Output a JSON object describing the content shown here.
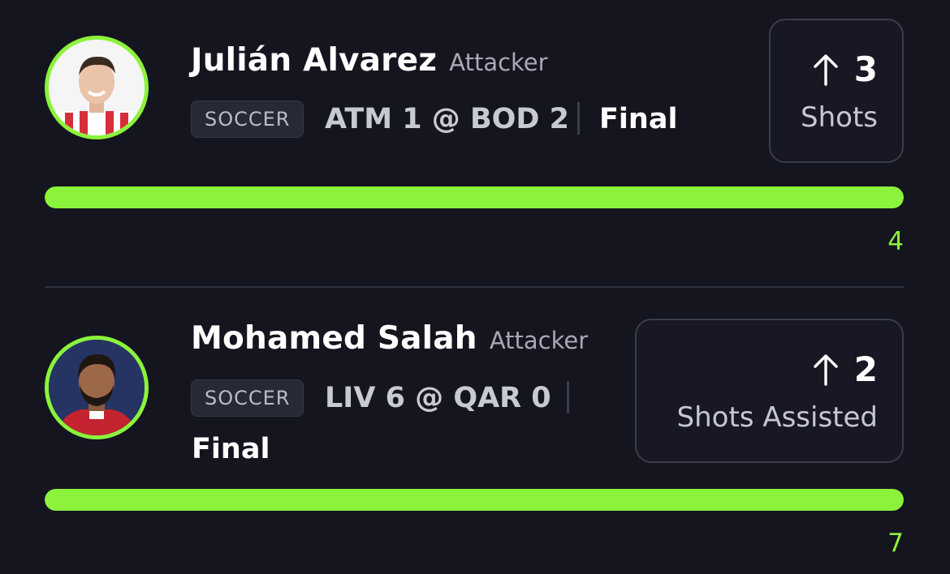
{
  "picks": [
    {
      "player": "Julián Alvarez",
      "position": "Attacker",
      "sport": "SOCCER",
      "score": "ATM 1 @ BOD 2",
      "status": "Final",
      "direction_icon": "arrow-up-icon",
      "line": "3",
      "stat": "Shots",
      "actual": "4",
      "progress": 1.0
    },
    {
      "player": "Mohamed Salah",
      "position": "Attacker",
      "sport": "SOCCER",
      "score": "LIV 6 @ QAR 0",
      "status": "Final",
      "direction_icon": "arrow-up-icon",
      "line": "2",
      "stat": "Shots Assisted",
      "actual": "7",
      "progress": 1.0
    }
  ],
  "colors": {
    "background": "#14151f",
    "accent": "#8bf33b",
    "card_border": "#3a3d4a"
  }
}
